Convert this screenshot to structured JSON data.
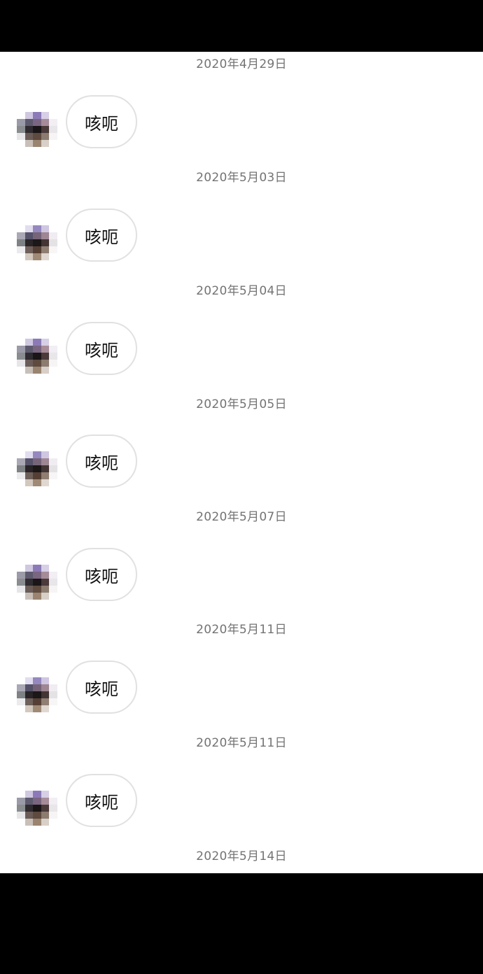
{
  "messages": [
    {
      "date": "2020年4月29日",
      "text": "咳呃"
    },
    {
      "date": "2020年5月03日",
      "text": "咳呃"
    },
    {
      "date": "2020年5月04日",
      "text": "咳呃"
    },
    {
      "date": "2020年5月05日",
      "text": "咳呃"
    },
    {
      "date": "2020年5月07日",
      "text": "咳呃"
    },
    {
      "date": "2020年5月11日",
      "text": "咳呃"
    },
    {
      "date": "2020年5月11日",
      "text": "咳呃"
    }
  ],
  "trailing_date": "2020年5月14日",
  "colors": {
    "background": "#ffffff",
    "date_text": "#737373",
    "bubble_border": "#e1e1e1",
    "frame": "#000000"
  }
}
